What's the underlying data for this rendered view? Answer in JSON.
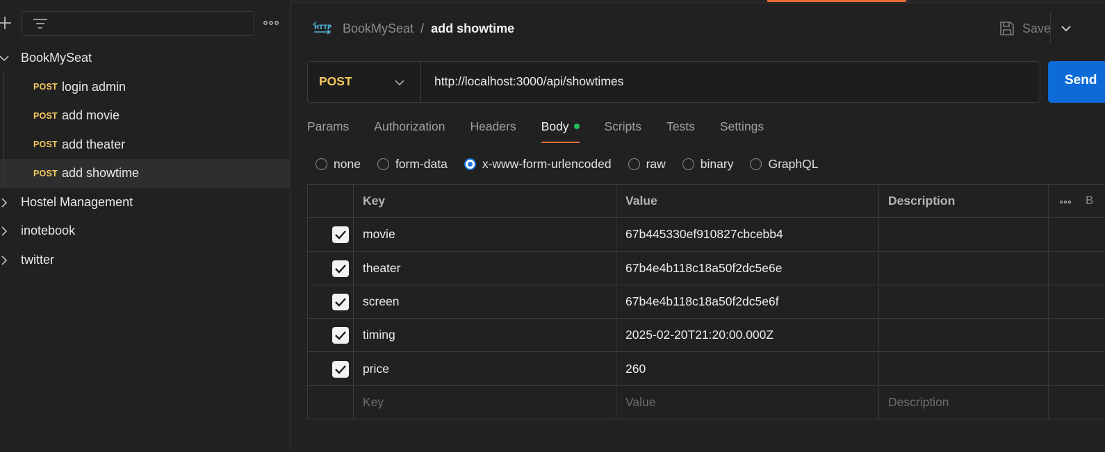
{
  "sidebar": {
    "collections": [
      {
        "name": "BookMySeat",
        "expanded": true,
        "requests": [
          {
            "method": "POST",
            "name": "login admin"
          },
          {
            "method": "POST",
            "name": "add movie"
          },
          {
            "method": "POST",
            "name": "add theater"
          },
          {
            "method": "POST",
            "name": "add showtime",
            "active": true
          }
        ]
      },
      {
        "name": "Hostel Management",
        "expanded": false
      },
      {
        "name": "inotebook",
        "expanded": false
      },
      {
        "name": "twitter",
        "expanded": false
      }
    ]
  },
  "header": {
    "breadcrumb_parent": "BookMySeat",
    "breadcrumb_sep": "/",
    "breadcrumb_current": "add showtime",
    "save_label": "Save"
  },
  "request": {
    "method": "POST",
    "url": "http://localhost:3000/api/showtimes",
    "send_label": "Send"
  },
  "tabs": [
    {
      "label": "Params"
    },
    {
      "label": "Authorization"
    },
    {
      "label": "Headers"
    },
    {
      "label": "Body",
      "active": true,
      "has_dot": true
    },
    {
      "label": "Scripts"
    },
    {
      "label": "Tests"
    },
    {
      "label": "Settings"
    }
  ],
  "body_options": [
    {
      "label": "none",
      "selected": false
    },
    {
      "label": "form-data",
      "selected": false
    },
    {
      "label": "x-www-form-urlencoded",
      "selected": true
    },
    {
      "label": "raw",
      "selected": false
    },
    {
      "label": "binary",
      "selected": false
    },
    {
      "label": "GraphQL",
      "selected": false
    }
  ],
  "table": {
    "headers": {
      "key": "Key",
      "value": "Value",
      "description": "Description",
      "bulk": "B"
    },
    "rows": [
      {
        "key": "movie",
        "value": "67b445330ef910827cbcebb4",
        "checked": true
      },
      {
        "key": "theater",
        "value": "67b4e4b118c18a50f2dc5e6e",
        "checked": true
      },
      {
        "key": "screen",
        "value": "67b4e4b118c18a50f2dc5e6f",
        "checked": true
      },
      {
        "key": "timing",
        "value": "2025-02-20T21:20:00.000Z",
        "checked": true
      },
      {
        "key": "price",
        "value": "260",
        "checked": true
      }
    ],
    "placeholder": {
      "key": "Key",
      "value": "Value",
      "description": "Description"
    }
  },
  "colors": {
    "post_method": "#f6c85f",
    "accent_tab": "#e86a3b",
    "send_button": "#0d6bd7",
    "body_dot": "#1fbf5a",
    "radio_selected": "#1976e6"
  },
  "icons": [
    "plus-icon",
    "filter-icon",
    "more-icon",
    "chevron-down-icon",
    "chevron-right-icon",
    "http-icon",
    "save-icon",
    "check-icon"
  ]
}
